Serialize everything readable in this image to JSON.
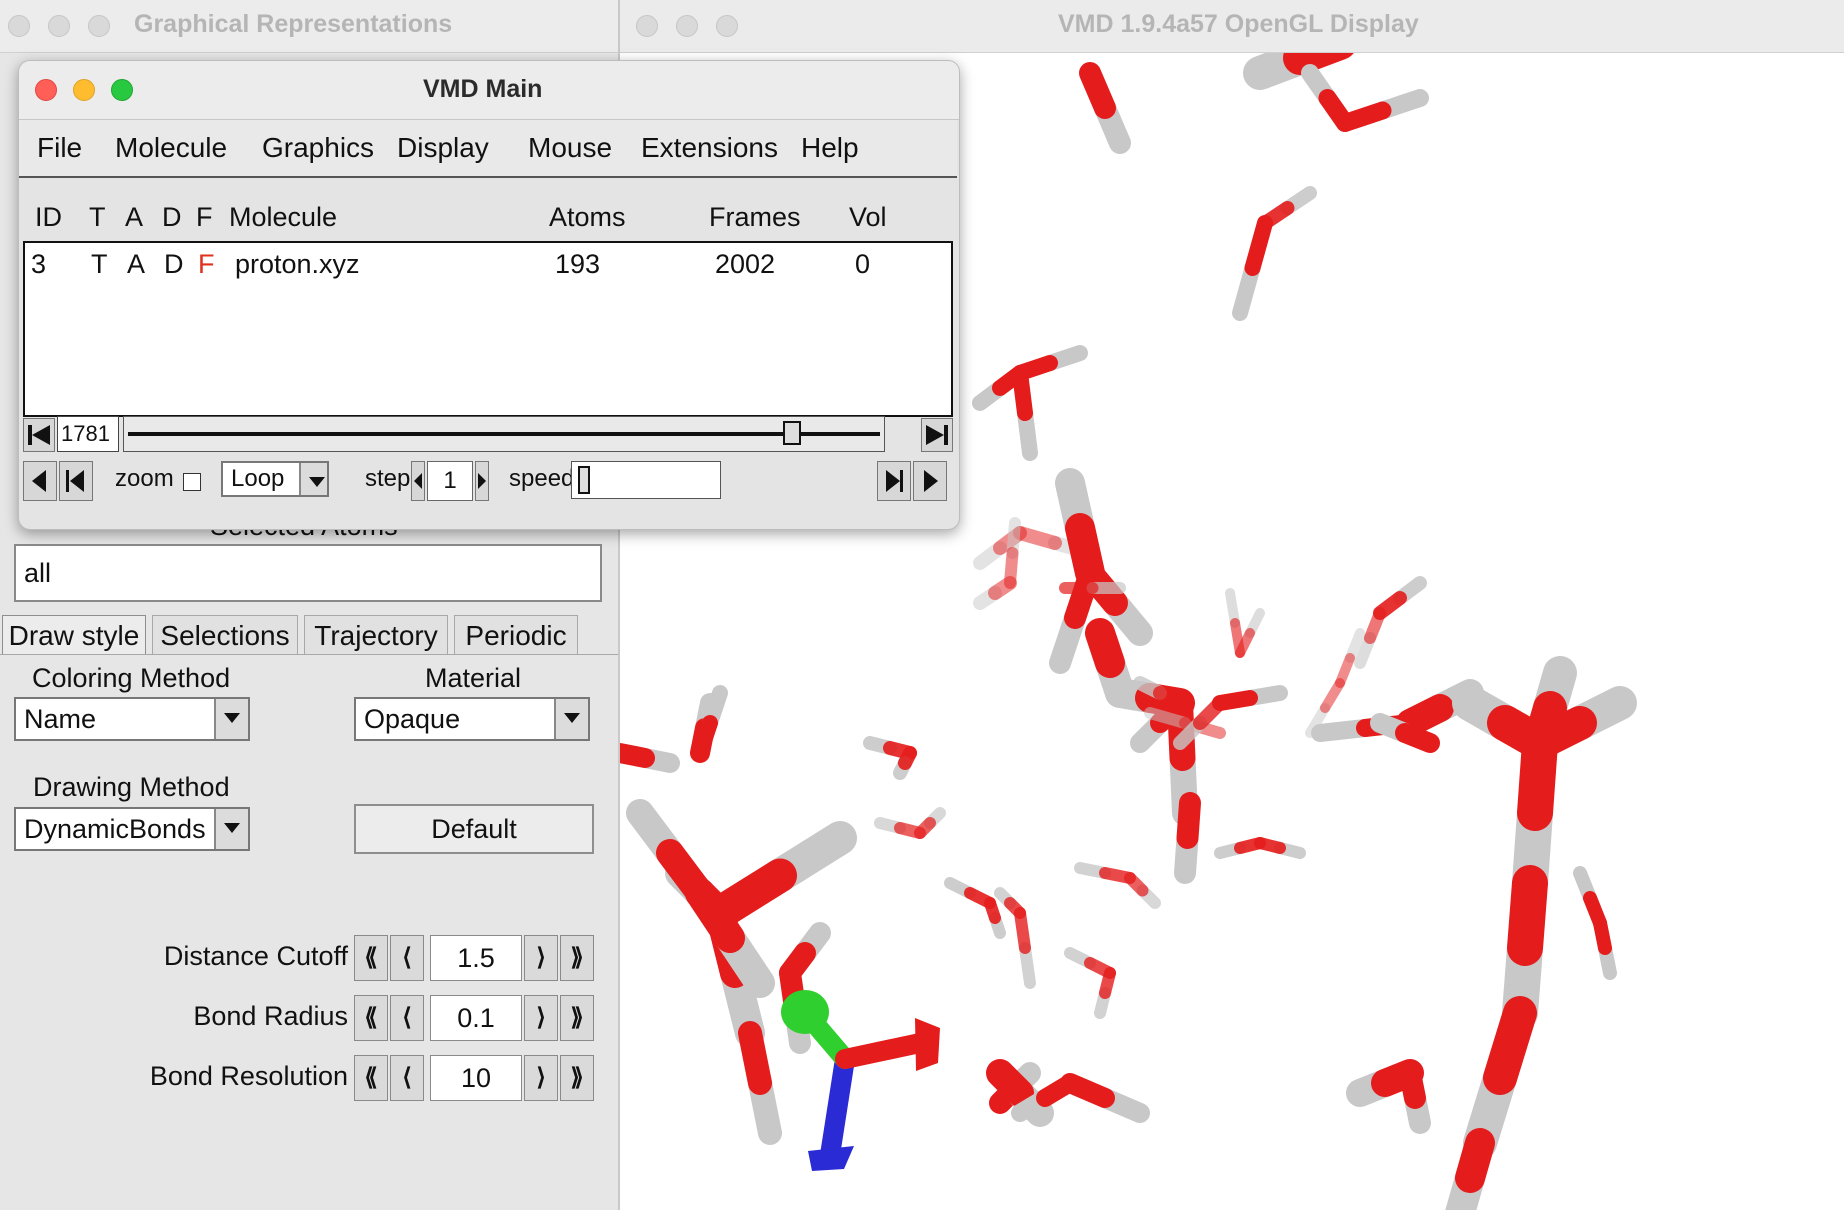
{
  "gl_window": {
    "title": "VMD 1.9.4a57 OpenGL Display",
    "colors": {
      "oxygen": "#e51c1c",
      "hydrogen": "#c8c8c8",
      "axis_x": "#e51c1c",
      "axis_y": "#2fcf2f",
      "axis_z": "#2b2bd6"
    }
  },
  "reps_window": {
    "title": "Graphical Representations",
    "selected_atoms_label": "Selected Atoms",
    "selection_text": "all",
    "tabs": [
      "Draw style",
      "Selections",
      "Trajectory",
      "Periodic"
    ],
    "coloring_method_label": "Coloring Method",
    "coloring_method_value": "Name",
    "material_label": "Material",
    "material_value": "Opaque",
    "drawing_method_label": "Drawing Method",
    "drawing_method_value": "DynamicBonds",
    "default_button": "Default",
    "params": [
      {
        "label": "Distance Cutoff",
        "value": "1.5"
      },
      {
        "label": "Bond Radius",
        "value": "0.1"
      },
      {
        "label": "Bond Resolution",
        "value": "10"
      }
    ]
  },
  "main_window": {
    "title": "VMD Main",
    "menus": [
      "File",
      "Molecule",
      "Graphics",
      "Display",
      "Mouse",
      "Extensions",
      "Help"
    ],
    "columns": {
      "id": "ID",
      "t": "T",
      "a": "A",
      "d": "D",
      "f": "F",
      "molecule": "Molecule",
      "atoms": "Atoms",
      "frames": "Frames",
      "vol": "Vol"
    },
    "molecule": {
      "id": "3",
      "t": "T",
      "a": "A",
      "d": "D",
      "f": "F",
      "name": "proton.xyz",
      "atoms": "193",
      "frames": "2002",
      "vol": "0"
    },
    "current_frame": "1781",
    "frame_fraction": 0.89,
    "zoom_label": "zoom",
    "loop_value": "Loop",
    "step_label": "step",
    "step_value": "1",
    "speed_label": "speed",
    "f_color": "#e0301e"
  }
}
